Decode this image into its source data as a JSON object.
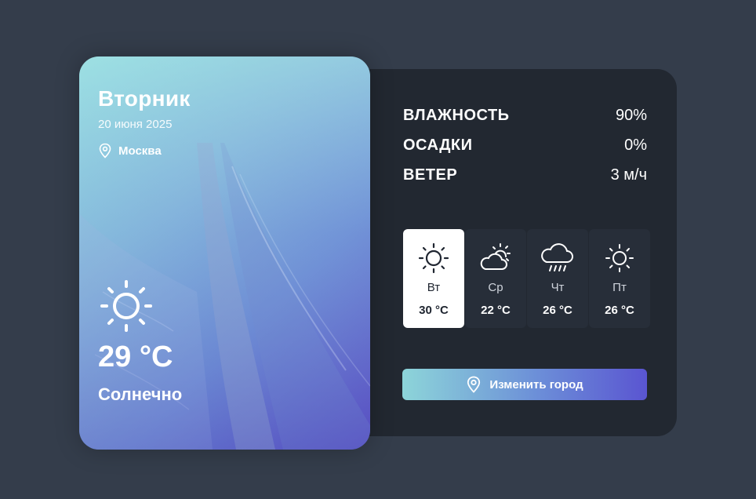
{
  "current": {
    "day": "Вторник",
    "date": "20 июня 2025",
    "location": "Москва",
    "temperature": "29 °C",
    "description": "Солнечно",
    "icon": "sun-icon"
  },
  "stats": [
    {
      "label": "ВЛАЖНОСТЬ",
      "value": "90%"
    },
    {
      "label": "ОСАДКИ",
      "value": "0%"
    },
    {
      "label": "ВЕТЕР",
      "value": "3 м/ч"
    }
  ],
  "forecast": [
    {
      "day": "Вт",
      "temp": "30 °C",
      "icon": "sun-icon",
      "active": true
    },
    {
      "day": "Ср",
      "temp": "22 °C",
      "icon": "partly-cloudy-icon",
      "active": false
    },
    {
      "day": "Чт",
      "temp": "26 °C",
      "icon": "rain-cloud-icon",
      "active": false
    },
    {
      "day": "Пт",
      "temp": "26 °C",
      "icon": "sun-icon",
      "active": false
    }
  ],
  "actions": {
    "change_city": "Изменить город"
  },
  "colors": {
    "background": "#343d4b",
    "panel": "#222831",
    "accent_start": "#8dd5d9",
    "accent_end": "#5a55d1"
  }
}
